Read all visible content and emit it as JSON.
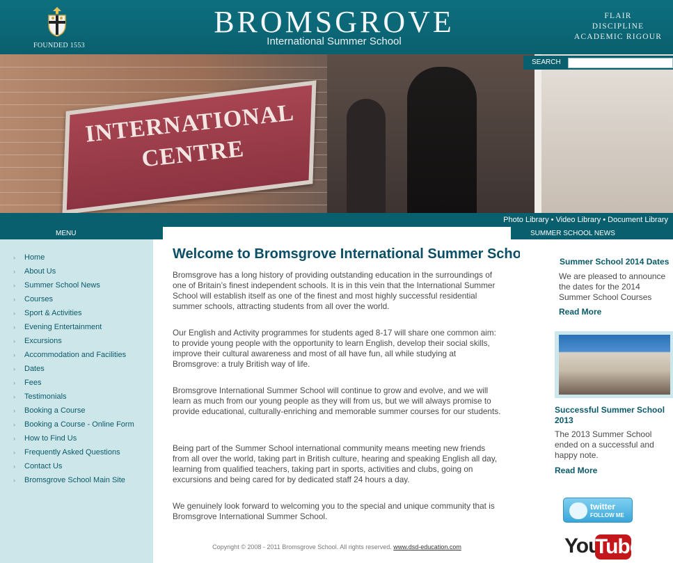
{
  "header": {
    "founded": "FOUNDED 1553",
    "brand": "BROMSGROVE",
    "brand_sub": "International Summer School",
    "motto": [
      "FLAIR",
      "DISCIPLINE",
      "ACADEMIC RIGOUR"
    ]
  },
  "search": {
    "label": "SEARCH",
    "placeholder": ""
  },
  "hero": {
    "sign_lines": [
      "INTERNATIONAL",
      "CENTRE"
    ]
  },
  "media_links": [
    "Photo Library",
    "Video Library",
    "Document Library"
  ],
  "nav": {
    "menu_label": "MENU",
    "news_label": "SUMMER SCHOOL NEWS",
    "items": [
      "Home",
      "About Us",
      "Summer School News",
      "Courses",
      "Sport & Activities",
      "Evening Entertainment",
      "Excursions",
      "Accommodation and Facilities",
      "Dates",
      "Fees",
      "Testimonials",
      "Booking a Course",
      "Booking a Course - Online Form",
      "How to Find Us",
      "Frequently Asked Questions",
      "Contact Us",
      "Bromsgrove School Main Site"
    ]
  },
  "main": {
    "title": "Welcome to Bromsgrove International Summer School",
    "paragraphs": [
      "Bromsgrove has a long history of providing outstanding education in the surroundings of one of Britain’s finest independent schools. It is in this vein that the International Summer School will establish itself as one of the finest and most highly successful residential summer schools, attracting students from all over the world.",
      "Our English and Activity programmes for students aged 8-17 will share one common aim: to provide young people with the opportunity to learn English, develop their social skills, improve their cultural awareness and most of all have fun, all while studying at Bromsgrove: a truly British way of life.",
      "Bromsgrove International Summer School will continue to grow and evolve, and we will learn as much from our young people as they will from us, but we will always promise to provide educational, culturally-enriching and memorable summer courses for our students.",
      "Being part of the Summer School international community means meeting new friends from all over the world, taking part in British culture, hearing and speaking English all day, learning from qualified teachers, taking part in sports, activities and clubs, going on excursions and being cared for by dedicated staff 24 hours a day.",
      "We genuinely look forward to welcoming you to the special and unique community that is Bromsgrove International Summer School."
    ],
    "copyright": "Copyright © 2008 - 2011 Bromsgrove School. All rights reserved.",
    "credit_link": "www.dsd-education.com"
  },
  "news": [
    {
      "title": "Summer School 2014 Dates",
      "body": "We are pleased to announce the dates for the 2014 Summer School Courses",
      "read_more": "Read More"
    },
    {
      "title": "Successful Summer School 2013",
      "body": "The 2013 Summer School ended on a successful and happy note.",
      "read_more": "Read More"
    }
  ],
  "social": {
    "twitter": "twitter",
    "twitter_follow": "FOLLOW ME",
    "youtube_you": "You",
    "youtube_tube": "Tube"
  },
  "colors": {
    "teal_dark": "#0a5f6e",
    "menu_bg": "#cce6ea",
    "link": "#0b5a6a",
    "title": "#0b4f66"
  }
}
